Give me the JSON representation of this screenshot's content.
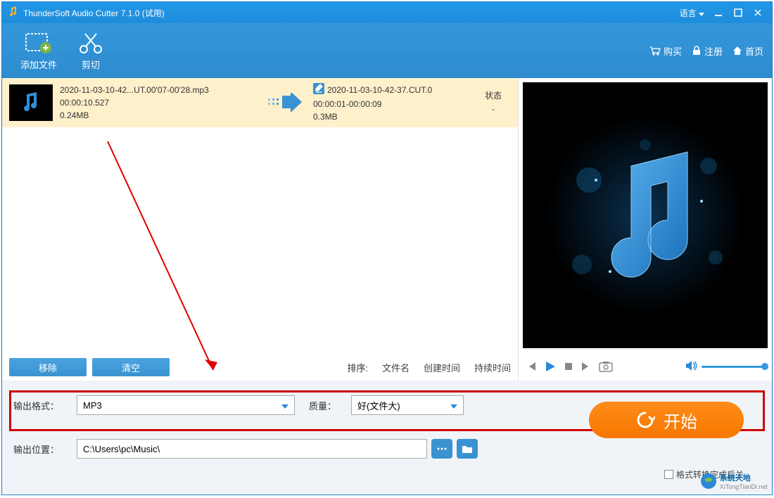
{
  "titlebar": {
    "title": "ThunderSoft Audio Cutter 7.1.0 (试用)",
    "language": "语言"
  },
  "toolbar": {
    "add_file": "添加文件",
    "cut": "剪切",
    "buy": "购买",
    "register": "注册",
    "home": "首页"
  },
  "list": {
    "src": {
      "filename": "2020-11-03-10-42...UT.00'07-00'28.mp3",
      "duration": "00:00:10.527",
      "size": "0.24MB"
    },
    "out": {
      "filename": "2020-11-03-10-42-37.CUT.0",
      "range": "00:00:01-00:00:09",
      "size": "0.3MB"
    },
    "status_header": "状态",
    "status_value": "-"
  },
  "buttons": {
    "remove": "移除",
    "clear": "清空"
  },
  "sort": {
    "label": "排序:",
    "filename": "文件名",
    "created": "创建时间",
    "duration": "持续时间"
  },
  "output": {
    "format_label": "输出格式：",
    "format_value": "MP3",
    "quality_label": "质量：",
    "quality_value": "好(文件大)",
    "path_label": "输出位置：",
    "path_value": "C:\\Users\\pc\\Music\\"
  },
  "start_label": "开始",
  "shutdown_label": "格式转换完成后关",
  "watermark": {
    "brand": "系统天地",
    "url": "XiTongTianDi.net"
  }
}
